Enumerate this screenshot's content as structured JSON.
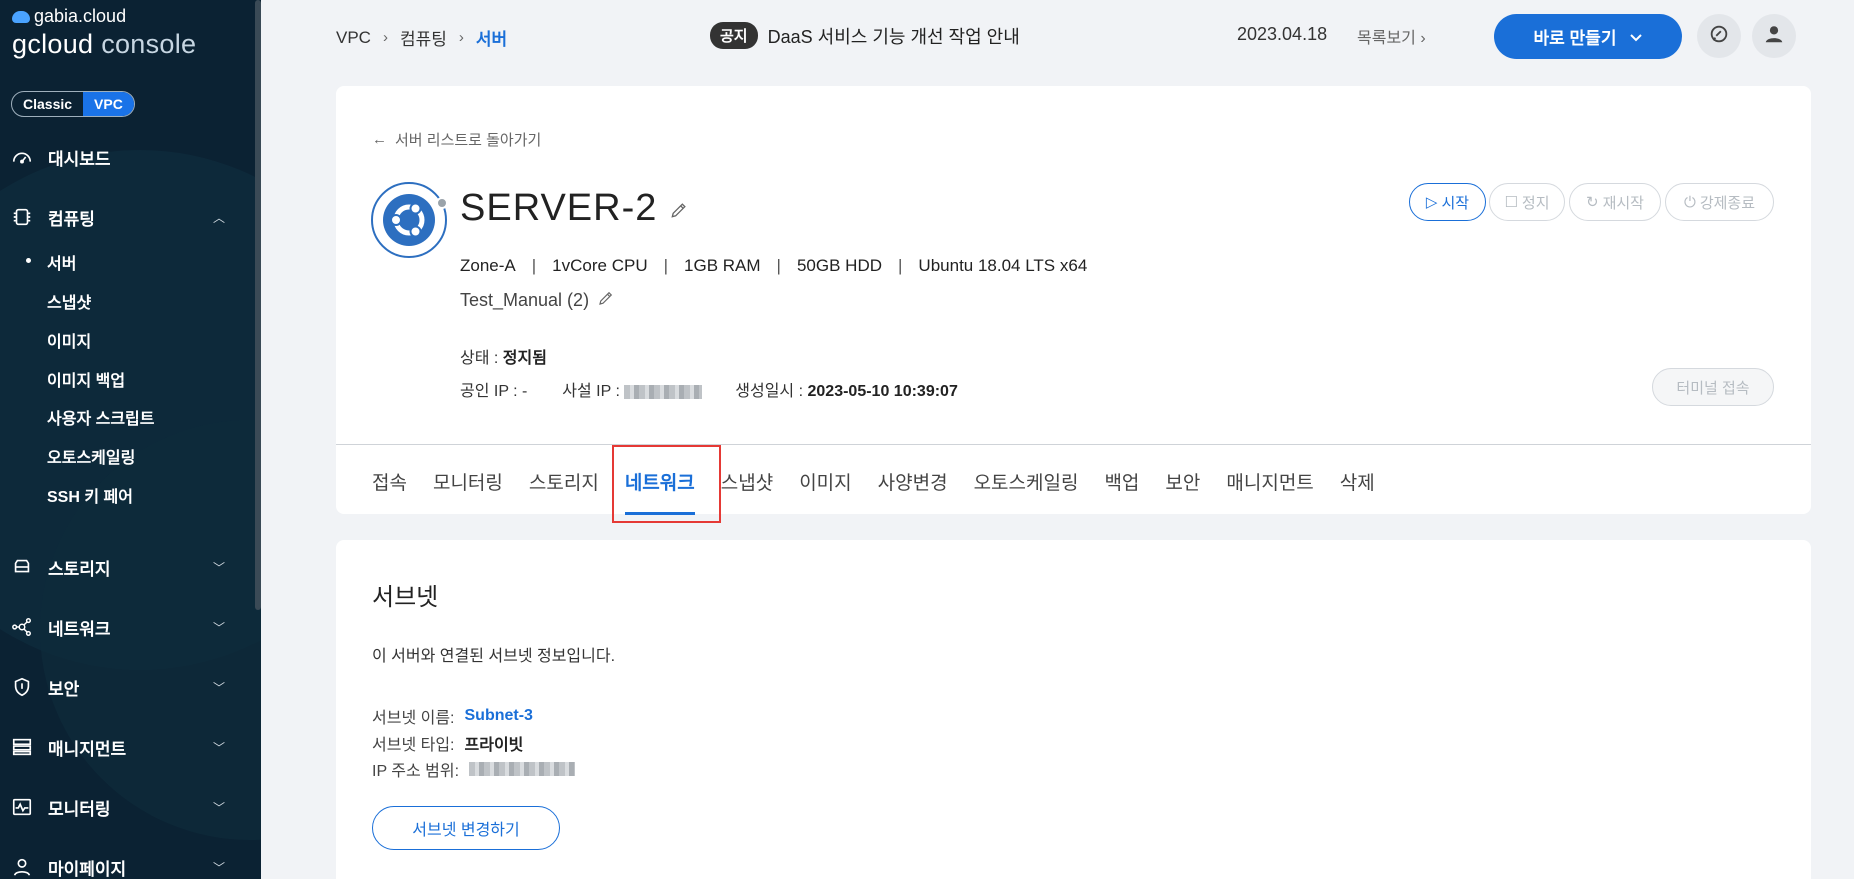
{
  "sidebar": {
    "brand_small": "gabia.cloud",
    "brand_big_1": "gcloud",
    "brand_big_2": "console",
    "toggle": {
      "classic": "Classic",
      "vpc": "VPC"
    },
    "items": [
      {
        "label": "대시보드",
        "icon": "dashboard-icon"
      },
      {
        "label": "컴퓨팅",
        "icon": "cpu-icon"
      },
      {
        "label": "스토리지",
        "icon": "storage-icon"
      },
      {
        "label": "네트워크",
        "icon": "network-icon"
      },
      {
        "label": "보안",
        "icon": "shield-icon"
      },
      {
        "label": "매니지먼트",
        "icon": "management-icon"
      },
      {
        "label": "모니터링",
        "icon": "monitor-icon"
      },
      {
        "label": "마이페이지",
        "icon": "user-icon"
      }
    ],
    "compute_sub": [
      "서버",
      "스냅샷",
      "이미지",
      "이미지 백업",
      "사용자 스크립트",
      "오토스케일링",
      "SSH 키 페어"
    ]
  },
  "header": {
    "breadcrumb": [
      "VPC",
      "컴퓨팅",
      "서버"
    ],
    "notice_tag": "공지",
    "notice_text": "DaaS 서비스 기능 개선 작업 안내",
    "notice_date": "2023.04.18",
    "notice_list": "목록보기",
    "make_button": "바로 만들기"
  },
  "server": {
    "back_link": "서버 리스트로 돌아가기",
    "name": "SERVER-2",
    "specs": [
      "Zone-A",
      "1vCore CPU",
      "1GB RAM",
      "50GB HDD",
      "Ubuntu 18.04 LTS x64"
    ],
    "group": "Test_Manual (2)",
    "controls": {
      "start": "시작",
      "stop": "정지",
      "restart": "재시작",
      "force_stop": "강제종료"
    },
    "status_label": "상태 :",
    "status_value": "정지됨",
    "public_ip_label": "공인 IP : -",
    "private_ip_label": "사설 IP :",
    "created_label": "생성일시 :",
    "created_value": "2023-05-10 10:39:07",
    "terminal_button": "터미널 접속"
  },
  "tabs": [
    "접속",
    "모니터링",
    "스토리지",
    "네트워크",
    "스냅샷",
    "이미지",
    "사양변경",
    "오토스케일링",
    "백업",
    "보안",
    "매니지먼트",
    "삭제"
  ],
  "active_tab": "네트워크",
  "subnet": {
    "title": "서브넷",
    "description": "이 서버와 연결된 서브넷 정보입니다.",
    "name_label": "서브넷 이름:",
    "name_value": "Subnet-3",
    "type_label": "서브넷 타입:",
    "type_value": "프라이빗",
    "range_label": "IP 주소 범위:",
    "change_button": "서브넷 변경하기"
  },
  "colors": {
    "accent": "#1a6fd8",
    "sidebar": "#0b2233",
    "highlight": "#e53935"
  }
}
